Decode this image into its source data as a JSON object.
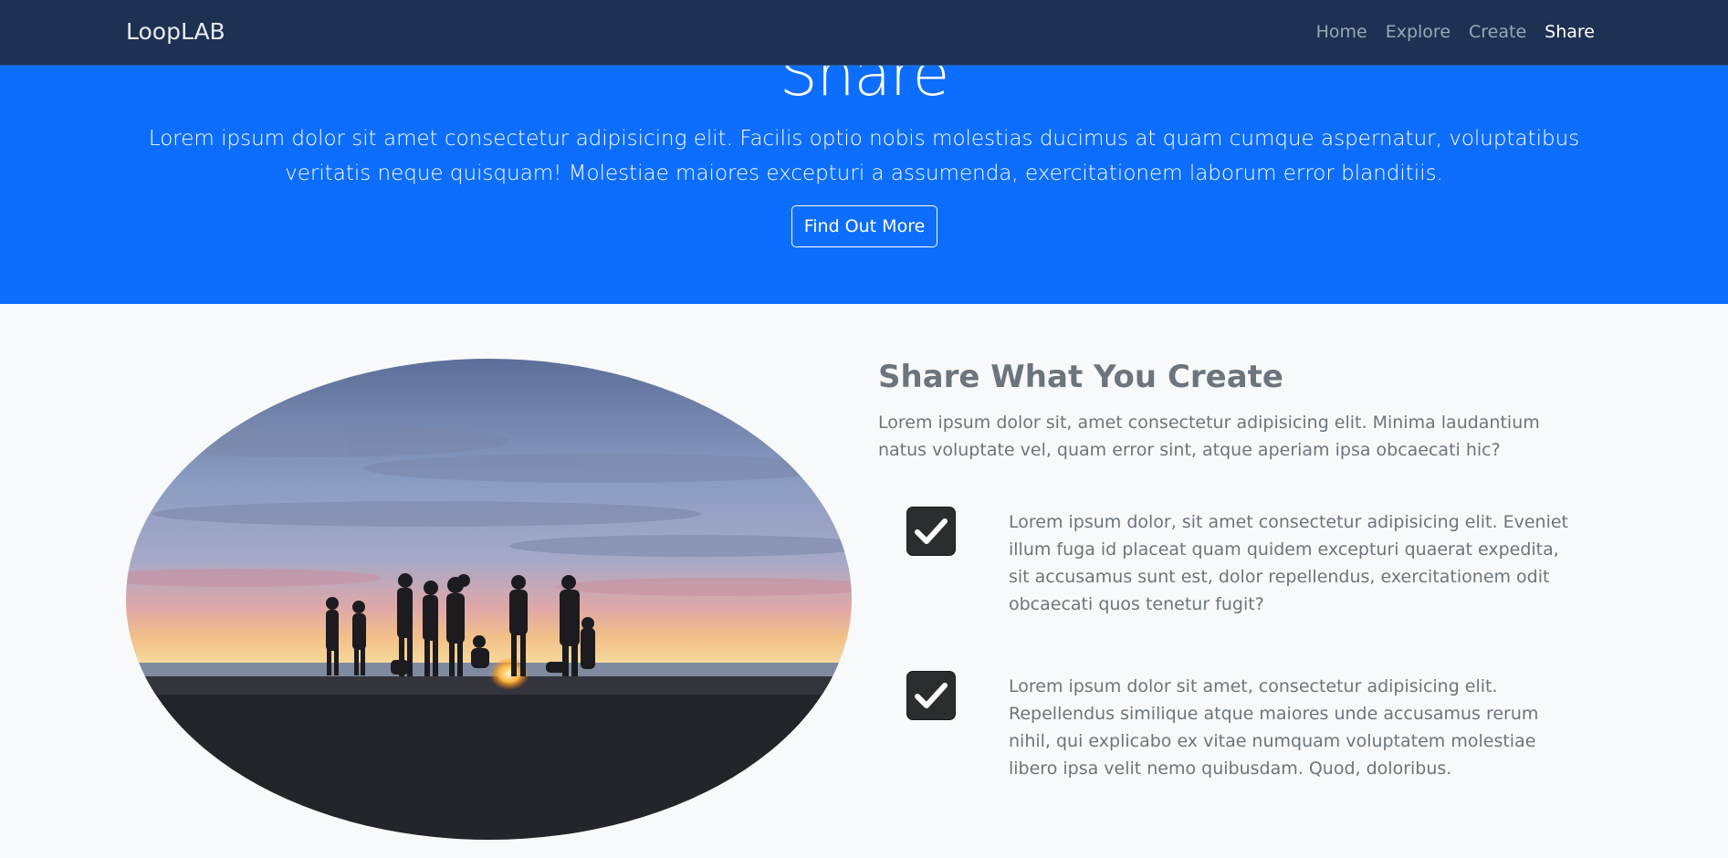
{
  "navbar": {
    "brand": "LoopLAB",
    "links": [
      {
        "label": "Home"
      },
      {
        "label": "Explore"
      },
      {
        "label": "Create"
      },
      {
        "label": "Share"
      }
    ]
  },
  "hero": {
    "title": "Share",
    "text": "Lorem ipsum dolor sit amet consectetur adipisicing elit. Facilis optio nobis molestias ducimus at quam cumque aspernatur, voluptatibus veritatis neque quisquam! Molestiae maiores excepturi a assumenda, exercitationem laborum error blanditiis.",
    "button_label": "Find Out More"
  },
  "content": {
    "title": "Share What You Create",
    "lead": "Lorem ipsum dolor sit, amet consectetur adipisicing elit. Minima laudantium natus voluptate vel, quam error sint, atque aperiam ipsa obcaecati hic?",
    "features": [
      {
        "icon": "check-square-icon",
        "text": "Lorem ipsum dolor, sit amet consectetur adipisicing elit. Eveniet illum fuga id placeat quam quidem excepturi quaerat expedita, sit accusamus sunt est, dolor repellendus, exercitationem odit obcaecati quos tenetur fugit?"
      },
      {
        "icon": "check-square-icon",
        "text": "Lorem ipsum dolor sit amet, consectetur adipisicing elit. Repellendus similique atque maiores unde accusamus rerum nihil, qui explicabo ex vitae numquam voluptatem molestiae libero ipsa velit nemo quibusdam. Quod, doloribus."
      }
    ]
  },
  "colors": {
    "navbar_bg": "#1e3153",
    "hero_bg": "#0d6efd",
    "page_bg": "#f8f9fa",
    "muted_text": "#6c757d"
  }
}
